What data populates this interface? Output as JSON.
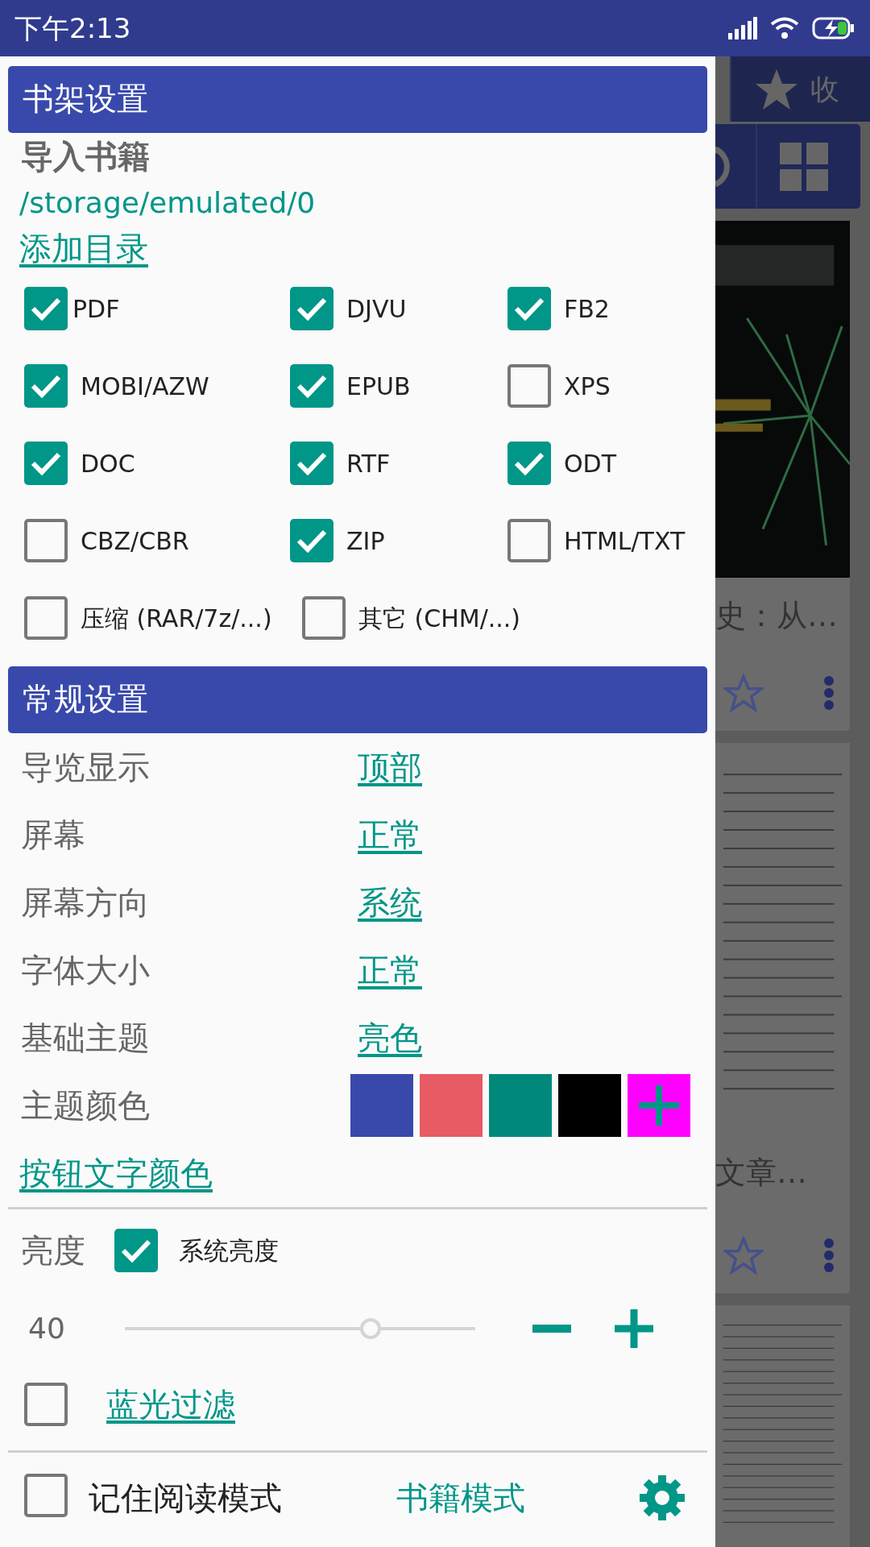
{
  "status_bar": {
    "time": "下午2:13"
  },
  "shelf_settings": {
    "title": "书架设置",
    "import_label": "导入书籍",
    "path": "/storage/emulated/0",
    "add_folder": "添加目录",
    "formats": [
      {
        "label": "PDF",
        "checked": true
      },
      {
        "label": "DJVU",
        "checked": true
      },
      {
        "label": "FB2",
        "checked": true
      },
      {
        "label": "MOBI/AZW",
        "checked": true
      },
      {
        "label": "EPUB",
        "checked": true
      },
      {
        "label": "XPS",
        "checked": false
      },
      {
        "label": "DOC",
        "checked": true
      },
      {
        "label": "RTF",
        "checked": true
      },
      {
        "label": "ODT",
        "checked": true
      },
      {
        "label": "CBZ/CBR",
        "checked": false
      },
      {
        "label": "ZIP",
        "checked": true
      },
      {
        "label": "HTML/TXT",
        "checked": false
      },
      {
        "label": "压缩 (RAR/7z/...)",
        "checked": false
      },
      {
        "label": "其它 (CHM/...)",
        "checked": false
      }
    ]
  },
  "general_settings": {
    "title": "常规设置",
    "rows": [
      {
        "label": "导览显示",
        "value": "顶部"
      },
      {
        "label": "屏幕",
        "value": "正常"
      },
      {
        "label": "屏幕方向",
        "value": "系统"
      },
      {
        "label": "字体大小",
        "value": "正常"
      },
      {
        "label": "基础主题",
        "value": "亮色"
      }
    ],
    "theme_color_label": "主题颜色",
    "theme_colors": [
      {
        "kind": "swatch",
        "color": "#3949ab"
      },
      {
        "kind": "swatch",
        "color": "#e85a64"
      },
      {
        "kind": "swatch",
        "color": "#00897b"
      },
      {
        "kind": "swatch",
        "color": "#000000"
      },
      {
        "kind": "add",
        "color": "#ff00ff"
      }
    ],
    "button_text_color": "按钮文字颜色"
  },
  "brightness": {
    "label": "亮度",
    "system_label": "系统亮度",
    "system_checked": true,
    "value": "40",
    "level": 0.7
  },
  "blue_light": {
    "label": "蓝光过滤",
    "checked": false
  },
  "remember_mode": {
    "label": "记住阅读模式",
    "checked": false,
    "value": "书籍模式"
  },
  "background": {
    "tab": "收",
    "books": [
      {
        "title": "史：从…",
        "kind": "cover"
      },
      {
        "title": "文章…",
        "kind": "document"
      }
    ]
  }
}
